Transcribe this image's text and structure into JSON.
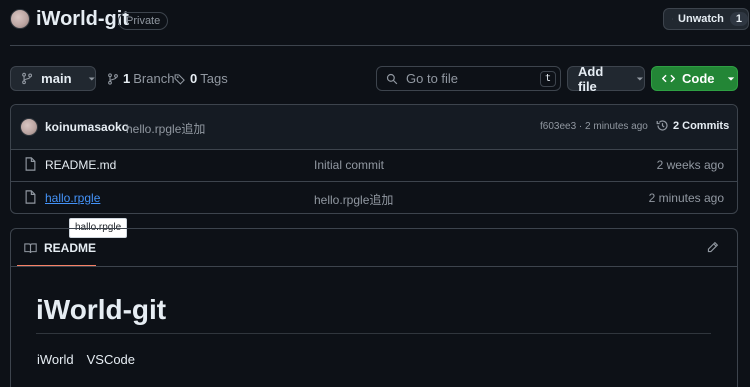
{
  "header": {
    "repo_name": "iWorld-git",
    "visibility": "Private",
    "unwatch_label": "Unwatch",
    "watch_count": "1"
  },
  "toolbar": {
    "branch": "main",
    "branch_count": "1",
    "branch_label": "Branch",
    "tag_count": "0",
    "tag_label": "Tags",
    "search_placeholder": "Go to file",
    "search_shortcut": "t",
    "add_file_label": "Add file",
    "code_label": "Code"
  },
  "commit": {
    "author": "koinumasaoko",
    "message": "hello.rpgle追加",
    "sha_time": "f603ee3 · 2 minutes ago",
    "commit_count": "2",
    "commits_label": "Commits"
  },
  "files": [
    {
      "name": "README.md",
      "message": "Initial commit",
      "time": "2 weeks ago"
    },
    {
      "name": "hallo.rpgle",
      "message": "hello.rpgle追加",
      "time": "2 minutes ago"
    }
  ],
  "tooltip": "hallo.rpgle",
  "readme": {
    "tab_label": "README",
    "heading": "iWorld-git",
    "body": "iWorld　VSCode"
  },
  "colors": {
    "background": "#0d1117",
    "accent_green": "#238636",
    "link_blue": "#4493f8",
    "tab_underline": "#f78166"
  }
}
